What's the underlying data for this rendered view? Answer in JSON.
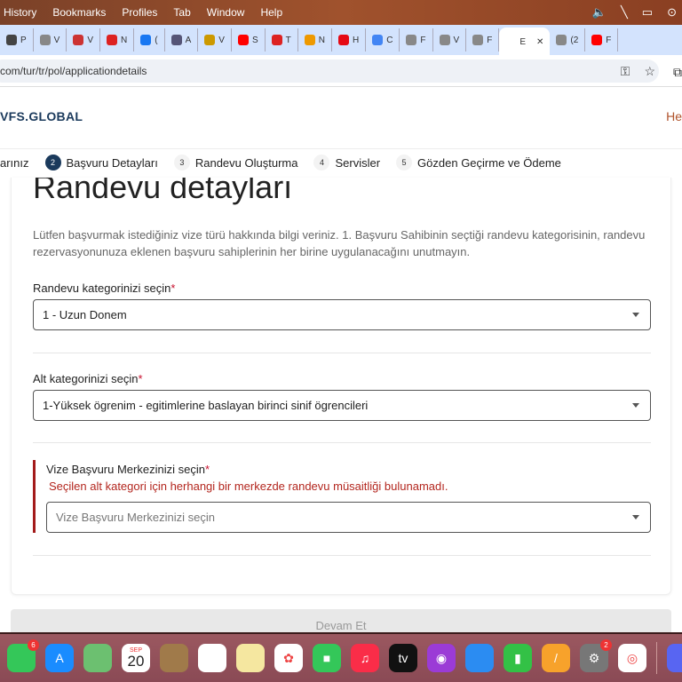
{
  "menubar": {
    "items": [
      "History",
      "Bookmarks",
      "Profiles",
      "Tab",
      "Window",
      "Help"
    ],
    "status_icons": [
      "volume-icon",
      "bluetooth-off-icon",
      "battery-icon",
      "play-icon"
    ]
  },
  "tabs": [
    {
      "icon": "chatgpt",
      "letter": "P",
      "color": "#444"
    },
    {
      "icon": "vfs",
      "letter": "V",
      "color": "#888"
    },
    {
      "icon": "poland-emblem",
      "letter": "V",
      "color": "#c33"
    },
    {
      "icon": "poland-flag",
      "letter": "N",
      "color": "#d22"
    },
    {
      "icon": "facebook",
      "letter": "(",
      "color": "#1877f2"
    },
    {
      "icon": "circle",
      "letter": "A",
      "color": "#557"
    },
    {
      "icon": "w-logo",
      "letter": "V",
      "color": "#c90"
    },
    {
      "icon": "youtube",
      "letter": "S",
      "color": "#f00"
    },
    {
      "icon": "tp",
      "letter": "T",
      "color": "#d22"
    },
    {
      "icon": "rainbow",
      "letter": "N",
      "color": "#e90"
    },
    {
      "icon": "netflix",
      "letter": "H",
      "color": "#e50914"
    },
    {
      "icon": "translate",
      "letter": "C",
      "color": "#4285f4"
    },
    {
      "icon": "vfs",
      "letter": "F",
      "color": "#888"
    },
    {
      "icon": "vfs",
      "letter": "V",
      "color": "#888"
    },
    {
      "icon": "vfs",
      "letter": "F",
      "color": "#888"
    },
    {
      "icon": "active",
      "letter": "E",
      "color": "#fff",
      "active": true
    },
    {
      "icon": "audio",
      "letter": "(2",
      "color": "#888"
    },
    {
      "icon": "youtube",
      "letter": "F",
      "color": "#f00"
    }
  ],
  "address": {
    "url": "com/tur/tr/pol/applicationdetails"
  },
  "header": {
    "logo": "VFS.GLOBAL",
    "right_link": "He"
  },
  "stepper": [
    {
      "num": "",
      "label": "arınız"
    },
    {
      "num": "2",
      "label": "Başvuru Detayları",
      "active": true
    },
    {
      "num": "3",
      "label": "Randevu Oluşturma"
    },
    {
      "num": "4",
      "label": "Servisler"
    },
    {
      "num": "5",
      "label": "Gözden Geçirme ve Ödeme"
    }
  ],
  "form": {
    "title": "Randevu detayları",
    "intro": "Lütfen başvurmak istediğiniz vize türü hakkında bilgi veriniz. 1. Başvuru Sahibinin seçtiği randevu kategorisinin, randevu rezervasyonunuza eklenen başvuru sahiplerinin her birine uygulanacağını unutmayın.",
    "category": {
      "label": "Randevu kategorinizi seçin",
      "required": "*",
      "value": "1 - Uzun Donem"
    },
    "subcategory": {
      "label": "Alt kategorinizi seçin",
      "required": "*",
      "value": "1-Yüksek ögrenim - egitimlerine baslayan birinci sinif ögrencileri"
    },
    "center": {
      "label": "Vize Başvuru Merkezinizi seçin",
      "required": "*",
      "error": "Seçilen alt kategori için herhangi bir merkezde randevu müsaitliği bulunamadı.",
      "placeholder": "Vize Başvuru Merkezinizi seçin"
    },
    "continue": "Devam Et"
  },
  "colors": {
    "primary": "#1b3a5c",
    "error": "#b3261e",
    "accent": "#b0532b"
  },
  "dock": [
    {
      "name": "messages",
      "badge": "6",
      "color": "#34c759"
    },
    {
      "name": "app-store",
      "color": "#1a8cff",
      "glyph": "A"
    },
    {
      "name": "maps",
      "color": "#6cc070"
    },
    {
      "name": "calendar",
      "color": "#fff",
      "month": "SEP",
      "day": "20"
    },
    {
      "name": "contacts",
      "color": "#a07a4a"
    },
    {
      "name": "reminders",
      "color": "#fff"
    },
    {
      "name": "notes",
      "color": "#f5e7a0"
    },
    {
      "name": "photos",
      "color": "#fff",
      "glyph": "✿"
    },
    {
      "name": "facetime",
      "color": "#34c759",
      "glyph": "■"
    },
    {
      "name": "music",
      "color": "#fa2d48",
      "glyph": "♫"
    },
    {
      "name": "apple-tv",
      "color": "#111",
      "glyph": "tv"
    },
    {
      "name": "podcasts",
      "color": "#9b3bd6",
      "glyph": "◉"
    },
    {
      "name": "keynote",
      "color": "#2b8cf2"
    },
    {
      "name": "numbers",
      "color": "#33c146",
      "glyph": "▮"
    },
    {
      "name": "pages",
      "color": "#f7a22b",
      "glyph": "/"
    },
    {
      "name": "system-settings",
      "badge": "2",
      "color": "#777",
      "glyph": "⚙"
    },
    {
      "name": "chrome",
      "color": "#fff",
      "glyph": "◎"
    },
    {
      "name": "discord",
      "color": "#5865f2"
    }
  ]
}
